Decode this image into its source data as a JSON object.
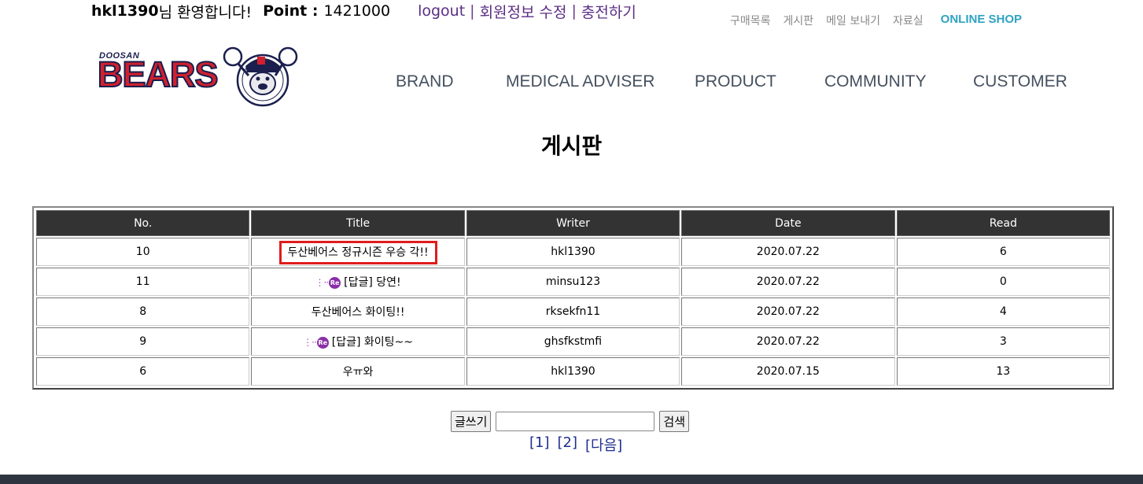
{
  "user": {
    "id": "hkl1390",
    "welcome_suffix": "님 환영합니다!",
    "point_label": "Point :",
    "point_value": "1421000",
    "logout": "logout",
    "sep": "|",
    "edit_profile": "회원정보 수정",
    "recharge": "충전하기"
  },
  "util_nav": [
    "구매목록",
    "게시판",
    "메일 보내기",
    "자료실"
  ],
  "online_shop": "ONLINE SHOP",
  "logo": {
    "small": "DOOSAN",
    "big": "BEARS"
  },
  "main_nav": [
    "BRAND",
    "MEDICAL ADVISER",
    "PRODUCT",
    "COMMUNITY",
    "CUSTOMER"
  ],
  "page_title": "게시판",
  "board": {
    "headers": [
      "No.",
      "Title",
      "Writer",
      "Date",
      "Read"
    ],
    "rows": [
      {
        "no": "10",
        "title": "두산베어스 정규시즌 우승 각!!",
        "writer": "hkl1390",
        "date": "2020.07.22",
        "read": "6",
        "reply": false,
        "highlight": true
      },
      {
        "no": "11",
        "title": "[답글] 당연!",
        "writer": "minsu123",
        "date": "2020.07.22",
        "read": "0",
        "reply": true,
        "highlight": false
      },
      {
        "no": "8",
        "title": "두산베어스 화이팅!!",
        "writer": "rksekfn11",
        "date": "2020.07.22",
        "read": "4",
        "reply": false,
        "highlight": false
      },
      {
        "no": "9",
        "title": "[답글] 화이팅~~",
        "writer": "ghsfkstmfi",
        "date": "2020.07.22",
        "read": "3",
        "reply": true,
        "highlight": false
      },
      {
        "no": "6",
        "title": "우ㅠ와",
        "writer": "hkl1390",
        "date": "2020.07.15",
        "read": "13",
        "reply": false,
        "highlight": false
      }
    ],
    "reply_badge": "Re",
    "highlight_color": "#e01b1b"
  },
  "controls": {
    "write_button": "글쓰기",
    "search_value": "",
    "search_button": "검색"
  },
  "pager": [
    "[1]",
    "[2]",
    "[다음]"
  ]
}
